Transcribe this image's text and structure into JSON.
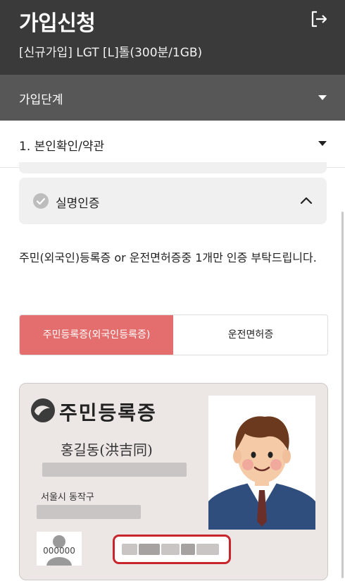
{
  "header": {
    "title": "가입신청",
    "subtitle": "[신규가입] LGT [L]톨(300분/1GB)",
    "logout_icon": "logout-icon"
  },
  "step_bar": {
    "label": "가입단계"
  },
  "sub_bar": {
    "label": "1. 본인확인/약관"
  },
  "verify": {
    "label": "실명인증",
    "expanded": true
  },
  "description": "주민(외국인)등록증 or 운전면허증중 1개만 인증 부탁드립니다.",
  "tabs": [
    {
      "label": "주민등록증(외국인등록증)",
      "active": true
    },
    {
      "label": "운전면허증",
      "active": false
    }
  ],
  "id_card": {
    "title": "주민등록증",
    "holder_name": "홍길동(洪吉同)",
    "address": "서울시 동작구",
    "thumb_code": "000000"
  },
  "colors": {
    "header_bg": "#3a3a3a",
    "step_bar_bg": "#575757",
    "active_tab": "#e46d6d",
    "highlight_border": "#c9252d",
    "card_bg": "#ece6e4"
  }
}
